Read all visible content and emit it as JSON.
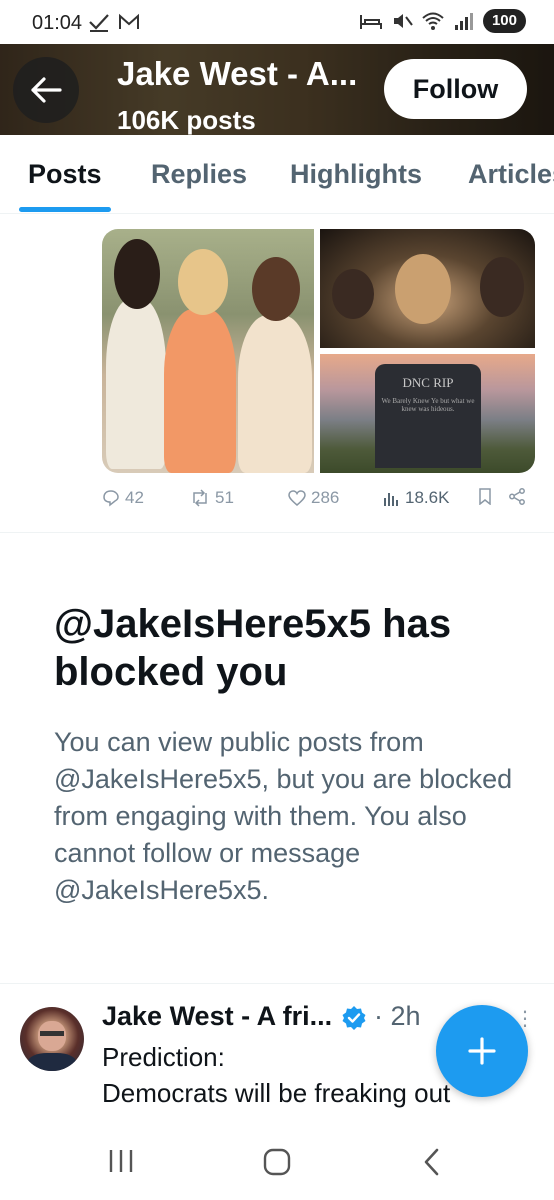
{
  "status_bar": {
    "time": "01:04",
    "battery": "100",
    "left_icons": [
      "check-icon",
      "mail-icon"
    ],
    "right_icons": [
      "bed-icon",
      "mute-icon",
      "wifi-icon",
      "signal-icon"
    ]
  },
  "header": {
    "title": "Jake West - A...",
    "subtitle": "106K posts",
    "follow_label": "Follow"
  },
  "tabs": [
    {
      "label": "Posts",
      "active": true
    },
    {
      "label": "Replies",
      "active": false
    },
    {
      "label": "Highlights",
      "active": false
    },
    {
      "label": "Articles",
      "active": false
    }
  ],
  "post_media": {
    "tombstone_title": "DNC RIP",
    "tombstone_text": "We Barely Knew Ye but what we knew was hideous."
  },
  "post_actions": {
    "replies": "42",
    "reposts": "51",
    "likes": "286",
    "views": "18.6K"
  },
  "blocked": {
    "title": "@JakeIsHere5x5 has blocked you",
    "body": "You can view public posts from @JakeIsHere5x5, but you are blocked from engaging with them. You also cannot follow or message @JakeIsHere5x5."
  },
  "next_post": {
    "author": "Jake West - A fri...",
    "time": "· 2h",
    "text": "Prediction:\nDemocrats will be freaking out"
  },
  "colors": {
    "accent": "#1d9bf0",
    "text_primary": "#0f1419",
    "text_secondary": "#536471"
  }
}
